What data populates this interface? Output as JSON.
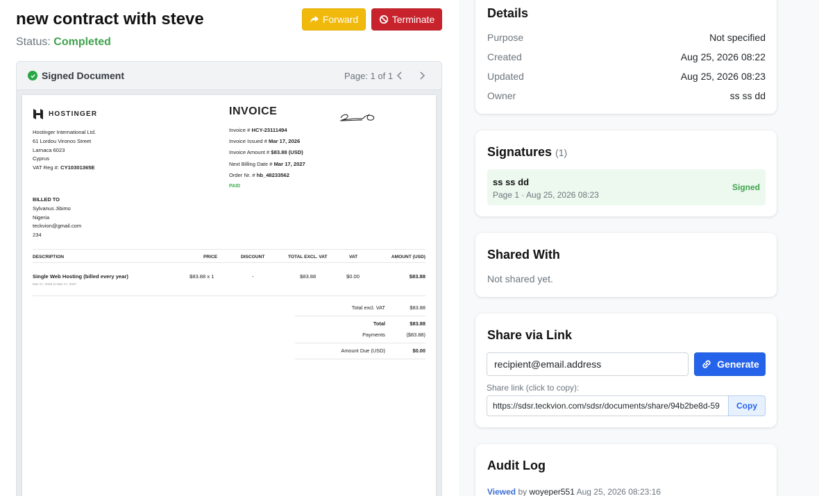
{
  "header": {
    "title": "new contract with steve",
    "status_label": "Status:",
    "status_value": "Completed",
    "forward_label": "Forward",
    "terminate_label": "Terminate"
  },
  "document": {
    "title": "Signed Document",
    "page_indicator": "Page: 1 of 1",
    "invoice": {
      "brand": "HOSTINGER",
      "company_lines": [
        "Hostinger International Ltd.",
        "61 Lordou Vironos Street",
        "Larnaca 6023",
        "Cyprus"
      ],
      "vat_reg_label": "VAT Reg #:",
      "vat_reg_value": "CY10301365E",
      "title": "INVOICE",
      "info": [
        {
          "label": "Invoice #",
          "value": "HCY-23111494"
        },
        {
          "label": "Invoice Issued #",
          "value": "Mar 17, 2026"
        },
        {
          "label": "Invoice Amount #",
          "value": "$83.88 (USD)"
        },
        {
          "label": "Next Billing Date #",
          "value": "Mar 17, 2027"
        },
        {
          "label": "Order Nr. #",
          "value": "hb_48233562"
        }
      ],
      "paid_label": "PAID",
      "billed_to_label": "BILLED TO",
      "billed_lines": [
        "Sylvanus Jibimo",
        "Nigeria",
        "teckvion@gmail.com",
        "234"
      ],
      "columns": [
        "DESCRIPTION",
        "PRICE",
        "DISCOUNT",
        "TOTAL EXCL. VAT",
        "VAT",
        "AMOUNT (USD)"
      ],
      "row": {
        "description": "Single Web Hosting (billed every year)",
        "period": "Mar 17, 2026 to Mar 17, 2027",
        "price": "$83.88 x 1",
        "discount": "-",
        "total_excl_vat": "$83.88",
        "vat": "$0.00",
        "amount": "$83.88"
      },
      "totals": {
        "total_excl_vat_label": "Total excl. VAT",
        "total_excl_vat_value": "$83.88",
        "total_label": "Total",
        "total_value": "$83.88",
        "payments_label": "Payments",
        "payments_value": "($83.88)",
        "amount_due_label": "Amount Due (USD)",
        "amount_due_value": "$0.00"
      }
    }
  },
  "details": {
    "title": "Details",
    "rows": [
      {
        "label": "Purpose",
        "value": "Not specified"
      },
      {
        "label": "Created",
        "value": "Aug 25, 2026 08:22"
      },
      {
        "label": "Updated",
        "value": "Aug 25, 2026 08:23"
      },
      {
        "label": "Owner",
        "value": "ss ss dd"
      }
    ]
  },
  "signatures": {
    "title": "Signatures",
    "count": "(1)",
    "items": [
      {
        "name": "ss ss dd",
        "meta": "Page 1 · Aug 25, 2026 08:23",
        "status": "Signed"
      }
    ]
  },
  "shared_with": {
    "title": "Shared With",
    "empty_text": "Not shared yet."
  },
  "share_link": {
    "title": "Share via Link",
    "email_value": "recipient@email.address",
    "generate_label": "Generate",
    "link_label": "Share link (click to copy):",
    "link_value": "https://sdsr.teckvion.com/sdsr/documents/share/94b2be8d-59",
    "copy_label": "Copy"
  },
  "audit_log": {
    "title": "Audit Log",
    "entries": [
      {
        "action": "Viewed",
        "by": "by",
        "user": "woyeper551",
        "time": "Aug 25, 2026 08:23:16"
      }
    ]
  },
  "colors": {
    "status_completed": "#3fa34d",
    "forward_button": "#f0b90b",
    "terminate_button": "#c8232c",
    "primary": "#2563eb",
    "signed_bg": "#edf8ef"
  }
}
